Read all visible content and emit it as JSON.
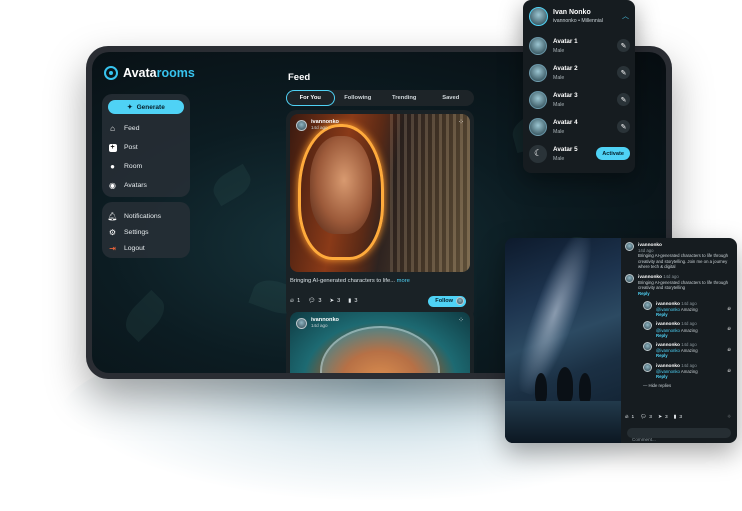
{
  "brand": {
    "name_a": "Avata",
    "name_b": "rooms"
  },
  "sidebar": {
    "generate_label": "Generate",
    "items": [
      {
        "label": "Feed",
        "icon": "home-icon"
      },
      {
        "label": "Post",
        "icon": "plus-square-icon"
      },
      {
        "label": "Room",
        "icon": "user-icon"
      },
      {
        "label": "Avatars",
        "icon": "user-circle-icon"
      }
    ],
    "bottom_items": [
      {
        "label": "Notifications",
        "icon": "bell-icon"
      },
      {
        "label": "Settings",
        "icon": "gear-icon"
      },
      {
        "label": "Logout",
        "icon": "logout-icon"
      }
    ]
  },
  "feed": {
    "title": "Feed",
    "tabs": [
      "For You",
      "Following",
      "Trending",
      "Saved"
    ],
    "post1": {
      "user": "ivannonko",
      "time": "14d ago",
      "caption": "Bringing AI-generated characters to life... ",
      "more": "more",
      "likes": "1",
      "comments": "3",
      "shares": "3",
      "saves": "3",
      "follow_label": "Follow"
    },
    "post2": {
      "user": "ivannonko",
      "time": "14d ago"
    }
  },
  "account_menu": {
    "name": "Ivan Nonko",
    "subtitle": "ivannonko • Millennial",
    "avatars": [
      {
        "name": "Avatar 1",
        "gender": "Male",
        "action": "edit"
      },
      {
        "name": "Avatar 2",
        "gender": "Male",
        "action": "edit"
      },
      {
        "name": "Avatar 3",
        "gender": "Male",
        "action": "edit"
      },
      {
        "name": "Avatar 4",
        "gender": "Male",
        "action": "edit"
      },
      {
        "name": "Avatar 5",
        "gender": "Male",
        "action": "Activate"
      }
    ]
  },
  "post_detail": {
    "author": "ivannonko",
    "author_time": "14d ago",
    "description": "Bringing AI-generated characters to life through creativity and storytelling. Join me on a journey where tech & digital",
    "comment": {
      "user": "ivannonko",
      "time": "14d ago",
      "text": "Bringing AI-generated characters to life through creativity and storytelling",
      "reply": "Reply"
    },
    "replies": [
      {
        "user": "ivannonko",
        "time": "14d ago",
        "mention": "@ivannonko",
        "text": "Amazing",
        "reply": "Reply"
      },
      {
        "user": "ivannonko",
        "time": "14d ago",
        "mention": "@ivannonko",
        "text": "Amazing",
        "reply": "Reply"
      },
      {
        "user": "ivannonko",
        "time": "14d ago",
        "mention": "@ivannonko",
        "text": "Amazing",
        "reply": "Reply"
      },
      {
        "user": "ivannonko",
        "time": "14d ago",
        "mention": "@ivannonko",
        "text": "Amazing",
        "reply": "Reply"
      }
    ],
    "hide_replies": "— Hide replies",
    "likes": "1",
    "comments": "3",
    "shares": "3",
    "saves": "3",
    "comment_placeholder": "Comment..."
  },
  "colors": {
    "accent": "#4fd2f5",
    "panel": "#161c20",
    "flame": "#ff9b2c"
  }
}
